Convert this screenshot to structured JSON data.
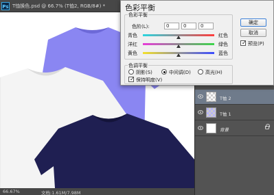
{
  "document": {
    "app_icon": "Ps",
    "title": "T恤换色.psd @ 66.7% (T恤2, RGB/8#) *",
    "status_zoom": "66.67%",
    "status_doc": "文档:1.61M/7.98M"
  },
  "dialog": {
    "title": "色彩平衡",
    "color_balance_group": "色彩平衡",
    "levels_label": "色阶(L):",
    "levels": [
      "0",
      "0",
      "0"
    ],
    "sliders": [
      {
        "left": "青色",
        "right": "红色",
        "value": 0
      },
      {
        "left": "洋红",
        "right": "绿色",
        "value": 0
      },
      {
        "left": "黄色",
        "right": "蓝色",
        "value": 0
      }
    ],
    "tone_group": "色调平衡",
    "tones": [
      "阴影(S)",
      "中间调(D)",
      "高光(H)"
    ],
    "selected_tone": "中间调(D)",
    "preserve_luminosity": "保持明度(V)",
    "preserve_luminosity_checked": true,
    "ok_label": "确定",
    "cancel_label": "取消",
    "preview_label": "预览(P)",
    "preview_checked": true
  },
  "layers": [
    {
      "name": "T恤 2",
      "selected": true,
      "thumbnail": "checker"
    },
    {
      "name": "T恤 1",
      "selected": false,
      "thumbnail": "checker-blue"
    },
    {
      "name": "背景",
      "selected": false,
      "thumbnail": "white",
      "locked": true
    }
  ],
  "colors": {
    "shirt_blue": "#8a86f2",
    "shirt_white": "#f4f4f4",
    "shirt_navy": "#1f1f52",
    "selected_layer": "#6f7b8b"
  }
}
